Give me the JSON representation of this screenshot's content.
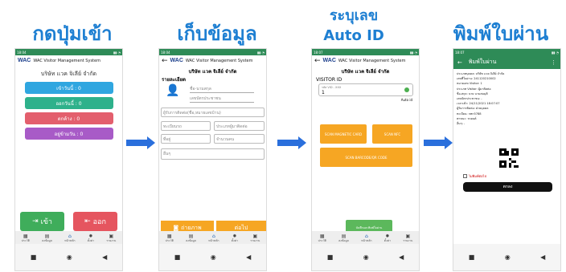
{
  "titles": {
    "step1": "กดปุ่มเข้า",
    "step2": "เก็บข้อมูล",
    "step3a": "ระบุเลข",
    "step3b": "Auto ID",
    "step4": "พิมพ์ใบผ่าน"
  },
  "colors": {
    "title": "#1e7fd2",
    "green": "#2e8b57",
    "orange": "#f6a623",
    "arrow": "#2a6fdc"
  },
  "status": {
    "s1_time": "18:04",
    "s2_time": "18:04",
    "s3_time": "18:07",
    "s4_time": "18:07"
  },
  "app": {
    "logo": "WAC",
    "system": "WAC Visitor Management System",
    "company": "บริษัท เเวค จิเลีย์ จำกัด"
  },
  "nav": [
    "ประวัติ",
    "ลงข้อมูล",
    "หน้าหลัก",
    "ตั้งค่า",
    "รายงาน"
  ],
  "screen1": {
    "stats": [
      "เข้าวันนี้ : 0",
      "ออกวันนี้ : 0",
      "ตกค้าง : 0",
      "อยู่ข้ามวัน : 0"
    ],
    "enter": "เข้า",
    "exit": "ออก"
  },
  "screen2": {
    "section": "รายละเอียด",
    "name_ph": "ชื่อ-นามสกุล",
    "id_ph": "เลขบัตรประชาชน",
    "contact_ph": "ผู้รับการติดต่อ(ชื่อ,หมายเลขบ้าน)",
    "plate_ph": "ทะเบียนรถ",
    "type_ph": "ประเภทผู้มาติดต่อ",
    "addr_ph": "ที่อยู่",
    "amount_ph": "จำนวนคน",
    "other_ph": "อื่นๆ",
    "photo": "ถ่ายภาพ",
    "next": "ต่อไป"
  },
  "screen3": {
    "label": "VISITOR ID",
    "sub": "รหัส VID - XXX",
    "value": "1",
    "auto": "Auto id",
    "b1": "SCAN MAGNETIC CARD",
    "b2": "SCAN NFC",
    "b3": "SCAN BARCODE/QR CODE",
    "save": "บันทึกและพิมพ์ใบผ่าน"
  },
  "screen4": {
    "title": "พิมพ์ใบผ่าน",
    "lines": [
      "ประเภทบุคคล: บริษัท เเวค จิเลีย์ จำกัด",
      "เลขที่ใบผ่าน: 241120210002",
      "หมายเลข Visitor: 1",
      "ประเภท Visitor: ผู้มาติดต่อ",
      "ชื่อ-สกุล: นาย นามสมมุติ",
      "เลขบัตรประชาชน: -",
      "เวลาเข้า: 24/11/2021 18:07:07",
      "ผู้รับการติดต่อ: ฝ่ายบุคคล",
      "ทะเบียน: กทก5788",
      "พาหนะ: รถยนต์",
      "อื่นๆ: -"
    ],
    "noprint": "ไม่พิมพ์ต่อไป",
    "ok": "ตกลง"
  }
}
